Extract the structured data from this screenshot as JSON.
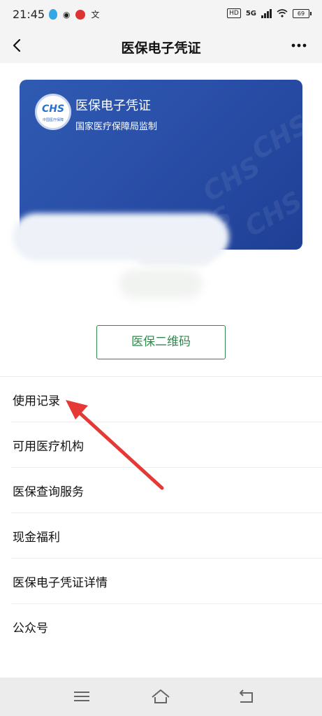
{
  "status_bar": {
    "time": "21:45",
    "network": "5G",
    "hd": "HD",
    "battery": "69"
  },
  "header": {
    "title": "医保电子凭证"
  },
  "card": {
    "title": "医保电子凭证",
    "subtitle": "国家医疗保障局监制",
    "logo_text": "CHS",
    "logo_subtext": "中国医疗保障",
    "color": "#2a4fa8"
  },
  "qr_button": {
    "label": "医保二维码",
    "color": "#2f8a4e"
  },
  "menu": {
    "items": [
      {
        "label": "使用记录"
      },
      {
        "label": "可用医疗机构"
      },
      {
        "label": "医保查询服务"
      },
      {
        "label": "现金福利"
      },
      {
        "label": "医保电子凭证详情"
      },
      {
        "label": "公众号"
      }
    ]
  },
  "annotation": {
    "arrow_color": "#e53935"
  }
}
